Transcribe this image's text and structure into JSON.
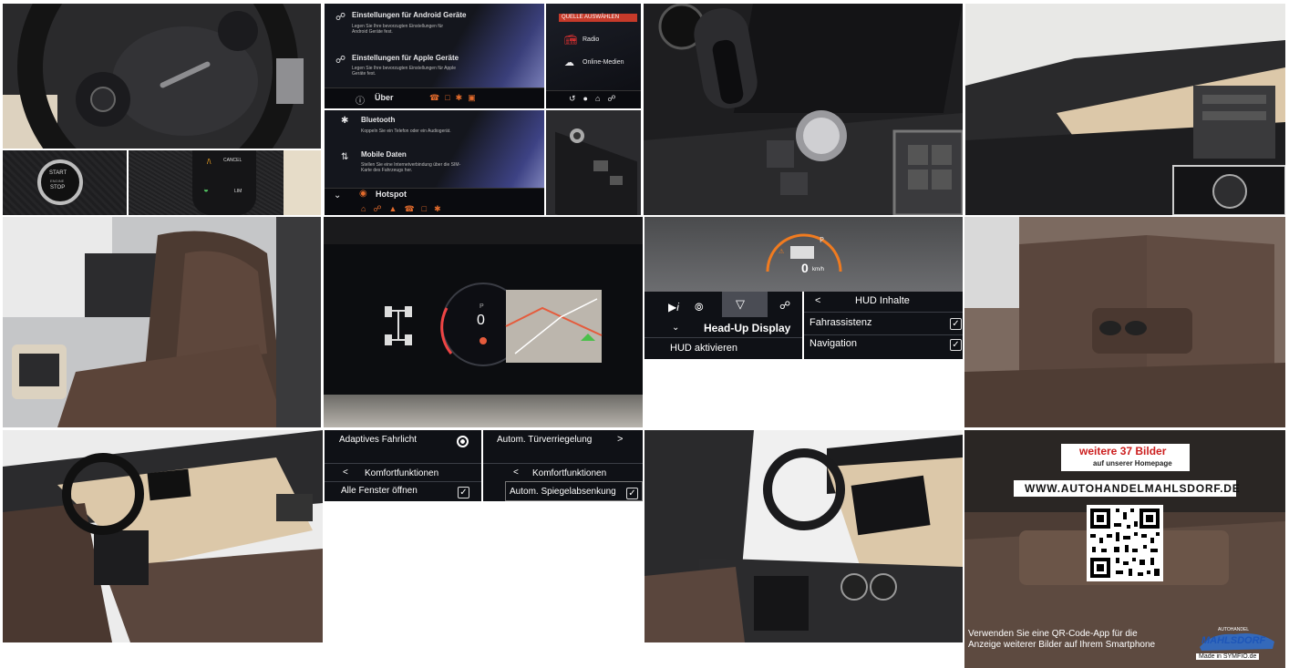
{
  "android_menu": {
    "android_title": "Einstellungen für Android Geräte",
    "android_desc": "Legen Sie Ihre bevorzugten Einstellungen für Android Geräte fest.",
    "apple_title": "Einstellungen für Apple Geräte",
    "apple_desc": "Legen Sie Ihre bevorzugten Einstellungen für Apple Geräte fest.",
    "about_label": "Über"
  },
  "source_menu": {
    "header": "QUELLE AUSWÄHLEN",
    "radio": "Radio",
    "online_media": "Online-Medien"
  },
  "bt_menu": {
    "bluetooth_title": "Bluetooth",
    "bluetooth_desc": "Koppeln Sie ein Telefon oder ein Audiogerät.",
    "mobile_title": "Mobile Daten",
    "mobile_desc": "Stellen Sie eine Internetverbindung über die SIM-Karte des Fahrzeugs her.",
    "hotspot_label": "Hotspot"
  },
  "start_button": {
    "line1": "START",
    "line2": "ENGINE",
    "line3": "STOP"
  },
  "steering_pad": {
    "cancel": "CANCEL",
    "lim": "LIM"
  },
  "cluster": {
    "speed": "0",
    "gear": "P"
  },
  "hud": {
    "speed": "0",
    "unit": "km/h",
    "menu_title": "Head-Up Display",
    "activate": "HUD aktivieren",
    "content_title": "HUD Inhalte",
    "items": [
      {
        "label": "Fahrassistenz",
        "checked": true
      },
      {
        "label": "Navigation",
        "checked": true
      }
    ]
  },
  "comfort_left": {
    "item": "Adaptives Fahrlicht",
    "back_title": "Komfortfunktionen",
    "option": "Alle Fenster öffnen"
  },
  "comfort_right": {
    "item": "Autom. Türverriegelung",
    "back_title": "Komfortfunktionen",
    "option": "Autom. Spiegelabsenkung"
  },
  "promo": {
    "headline": "weitere 37 Bilder",
    "subline": "auf unserer Homepage",
    "url": "WWW.AUTOHANDELMAHLSDORF.DE",
    "footer": "Verwenden Sie eine QR-Code-App für die Anzeige weiterer Bilder auf Ihrem Smartphone",
    "logo_top": "AUTOHANDEL",
    "logo_main": "MAHLSDORF",
    "made_in": "Made in SYMFIO.de",
    "accent": "#cc1f1f"
  }
}
